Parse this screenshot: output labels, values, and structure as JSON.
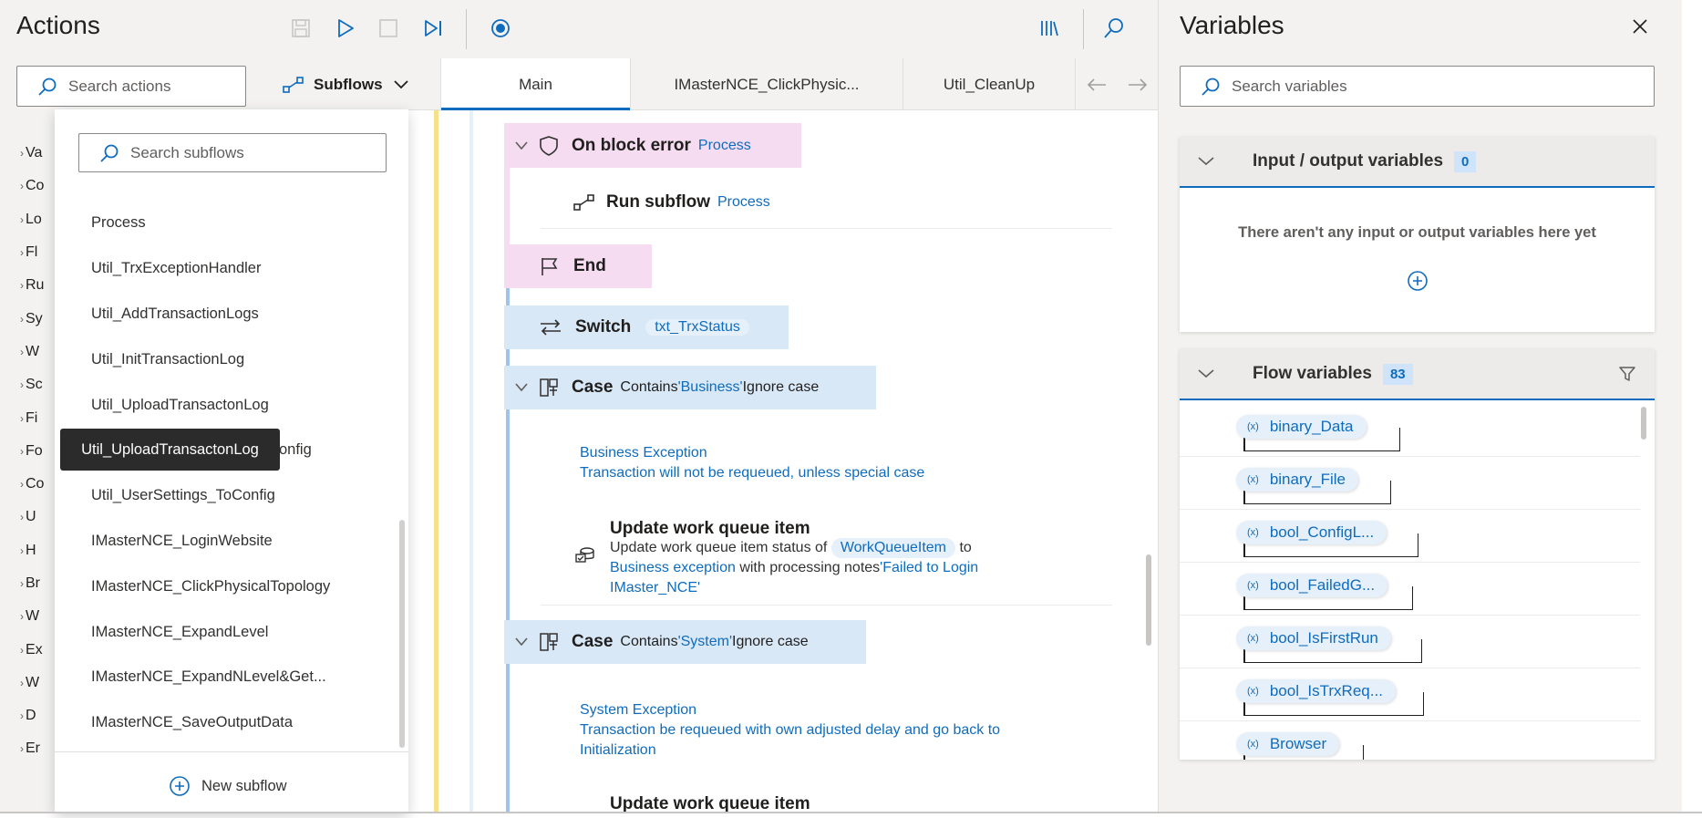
{
  "actions_pane": {
    "title": "Actions",
    "search_placeholder": "Search actions",
    "categories": [
      "Va",
      "Co",
      "Lo",
      "Fl",
      "Ru",
      "Sy",
      "W",
      "Sc",
      "Fi",
      "Fo",
      "Co",
      "U",
      "H",
      "Br",
      "W",
      "Ex",
      "W",
      "D",
      "Er"
    ]
  },
  "subflows": {
    "button_label": "Subflows",
    "search_placeholder": "Search subflows",
    "items": [
      "Process",
      "Util_TrxExceptionHandler",
      "Util_AddTransactionLogs",
      "Util_InitTransactionLog",
      "Util_UploadTransactonLog",
      "onfig",
      "Util_UserSettings_ToConfig",
      "IMasterNCE_LoginWebsite",
      "IMasterNCE_ClickPhysicalTopology",
      "IMasterNCE_ExpandLevel",
      "IMasterNCE_ExpandNLevel&Get...",
      "IMasterNCE_SaveOutputData"
    ],
    "tooltip": "Util_UploadTransactonLog",
    "new_subflow_label": "New subflow"
  },
  "tabs": [
    "Main",
    "IMasterNCE_ClickPhysic...",
    "Util_CleanUp"
  ],
  "flow": {
    "on_block_error": {
      "keyword": "On block error",
      "arg": "Process"
    },
    "run_subflow": {
      "keyword": "Run subflow",
      "arg": "Process"
    },
    "end": {
      "keyword": "End"
    },
    "switch": {
      "keyword": "Switch",
      "arg": "txt_TrxStatus"
    },
    "case1": {
      "keyword": "Case",
      "pre": "Contains",
      "value": "'Business'",
      "post": "Ignore case"
    },
    "comment1_line1": "Business Exception",
    "comment1_line2": "Transaction will not be requeued, unless special case",
    "update1": {
      "title": "Update work queue item",
      "desc_pre": "Update work queue item status of",
      "var": "WorkQueueItem",
      "to": "to",
      "status": "Business exception",
      "with": "with processing notes",
      "notes_line1": "'Failed to Login",
      "notes_line2": "IMaster_NCE'"
    },
    "case2": {
      "keyword": "Case",
      "pre": "Contains",
      "value": "'System'",
      "post": "Ignore case"
    },
    "comment2_line1": "System Exception",
    "comment2_line2": "Transaction be requeued with own adjusted delay and go back to",
    "comment2_line3": "Initialization",
    "update2_title": "Update work queue item"
  },
  "variables_pane": {
    "title": "Variables",
    "search_placeholder": "Search variables",
    "io": {
      "title": "Input / output variables",
      "count": "0",
      "empty_text": "There aren't any input or output variables here yet"
    },
    "flow": {
      "title": "Flow variables",
      "count": "83",
      "items": [
        "binary_Data",
        "binary_File",
        "bool_ConfigL...",
        "bool_FailedG...",
        "bool_IsFirstRun",
        "bool_IsTrxReq...",
        "Browser"
      ],
      "var_icon": "(x)"
    }
  }
}
